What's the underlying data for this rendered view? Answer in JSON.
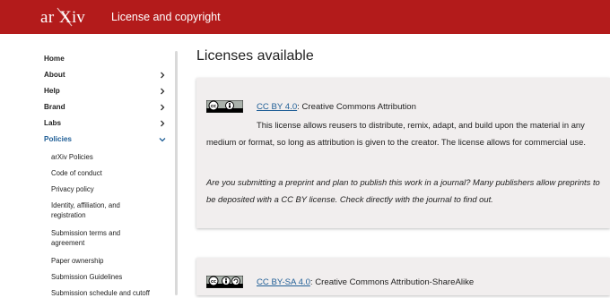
{
  "header": {
    "logo_text": "arXiv",
    "title": "License and copyright"
  },
  "sidebar": {
    "nav": [
      {
        "label": "Home",
        "chevron": "none"
      },
      {
        "label": "About",
        "chevron": "right"
      },
      {
        "label": "Help",
        "chevron": "right"
      },
      {
        "label": "Brand",
        "chevron": "right"
      },
      {
        "label": "Labs",
        "chevron": "right"
      },
      {
        "label": "Policies",
        "chevron": "down",
        "active": true
      }
    ],
    "subitems": [
      "arXiv Policies",
      "Code of conduct",
      "Privacy policy",
      "Identity, affiliation, and registration",
      "Submission terms and agreement",
      "Paper ownership",
      "Submission Guidelines",
      "Submission schedule and cutoff"
    ]
  },
  "main": {
    "title": "Licenses available",
    "licenses": [
      {
        "link": "CC BY 4.0",
        "name": ": Creative Commons Attribution",
        "description": "This license allows reusers to distribute, remix, adapt, and build upon the material in any medium or format, so long as attribution is given to the creator. The license allows for commercial use.",
        "note": "Are you submitting a preprint and plan to publish this work in a journal? Many publishers allow preprints to be deposited with a CC BY license. Check directly with the journal to find out."
      },
      {
        "link": "CC BY-SA 4.0",
        "name": ": Creative Commons Attribution-ShareAlike"
      }
    ]
  },
  "colors": {
    "brand_red": "#b31b1b",
    "link_blue": "#1f5e96",
    "card_bg": "#f1eeee"
  },
  "icons": [
    "arxiv-logo",
    "chevron-right-icon",
    "chevron-down-icon",
    "cc-by-badge",
    "cc-by-sa-badge"
  ]
}
